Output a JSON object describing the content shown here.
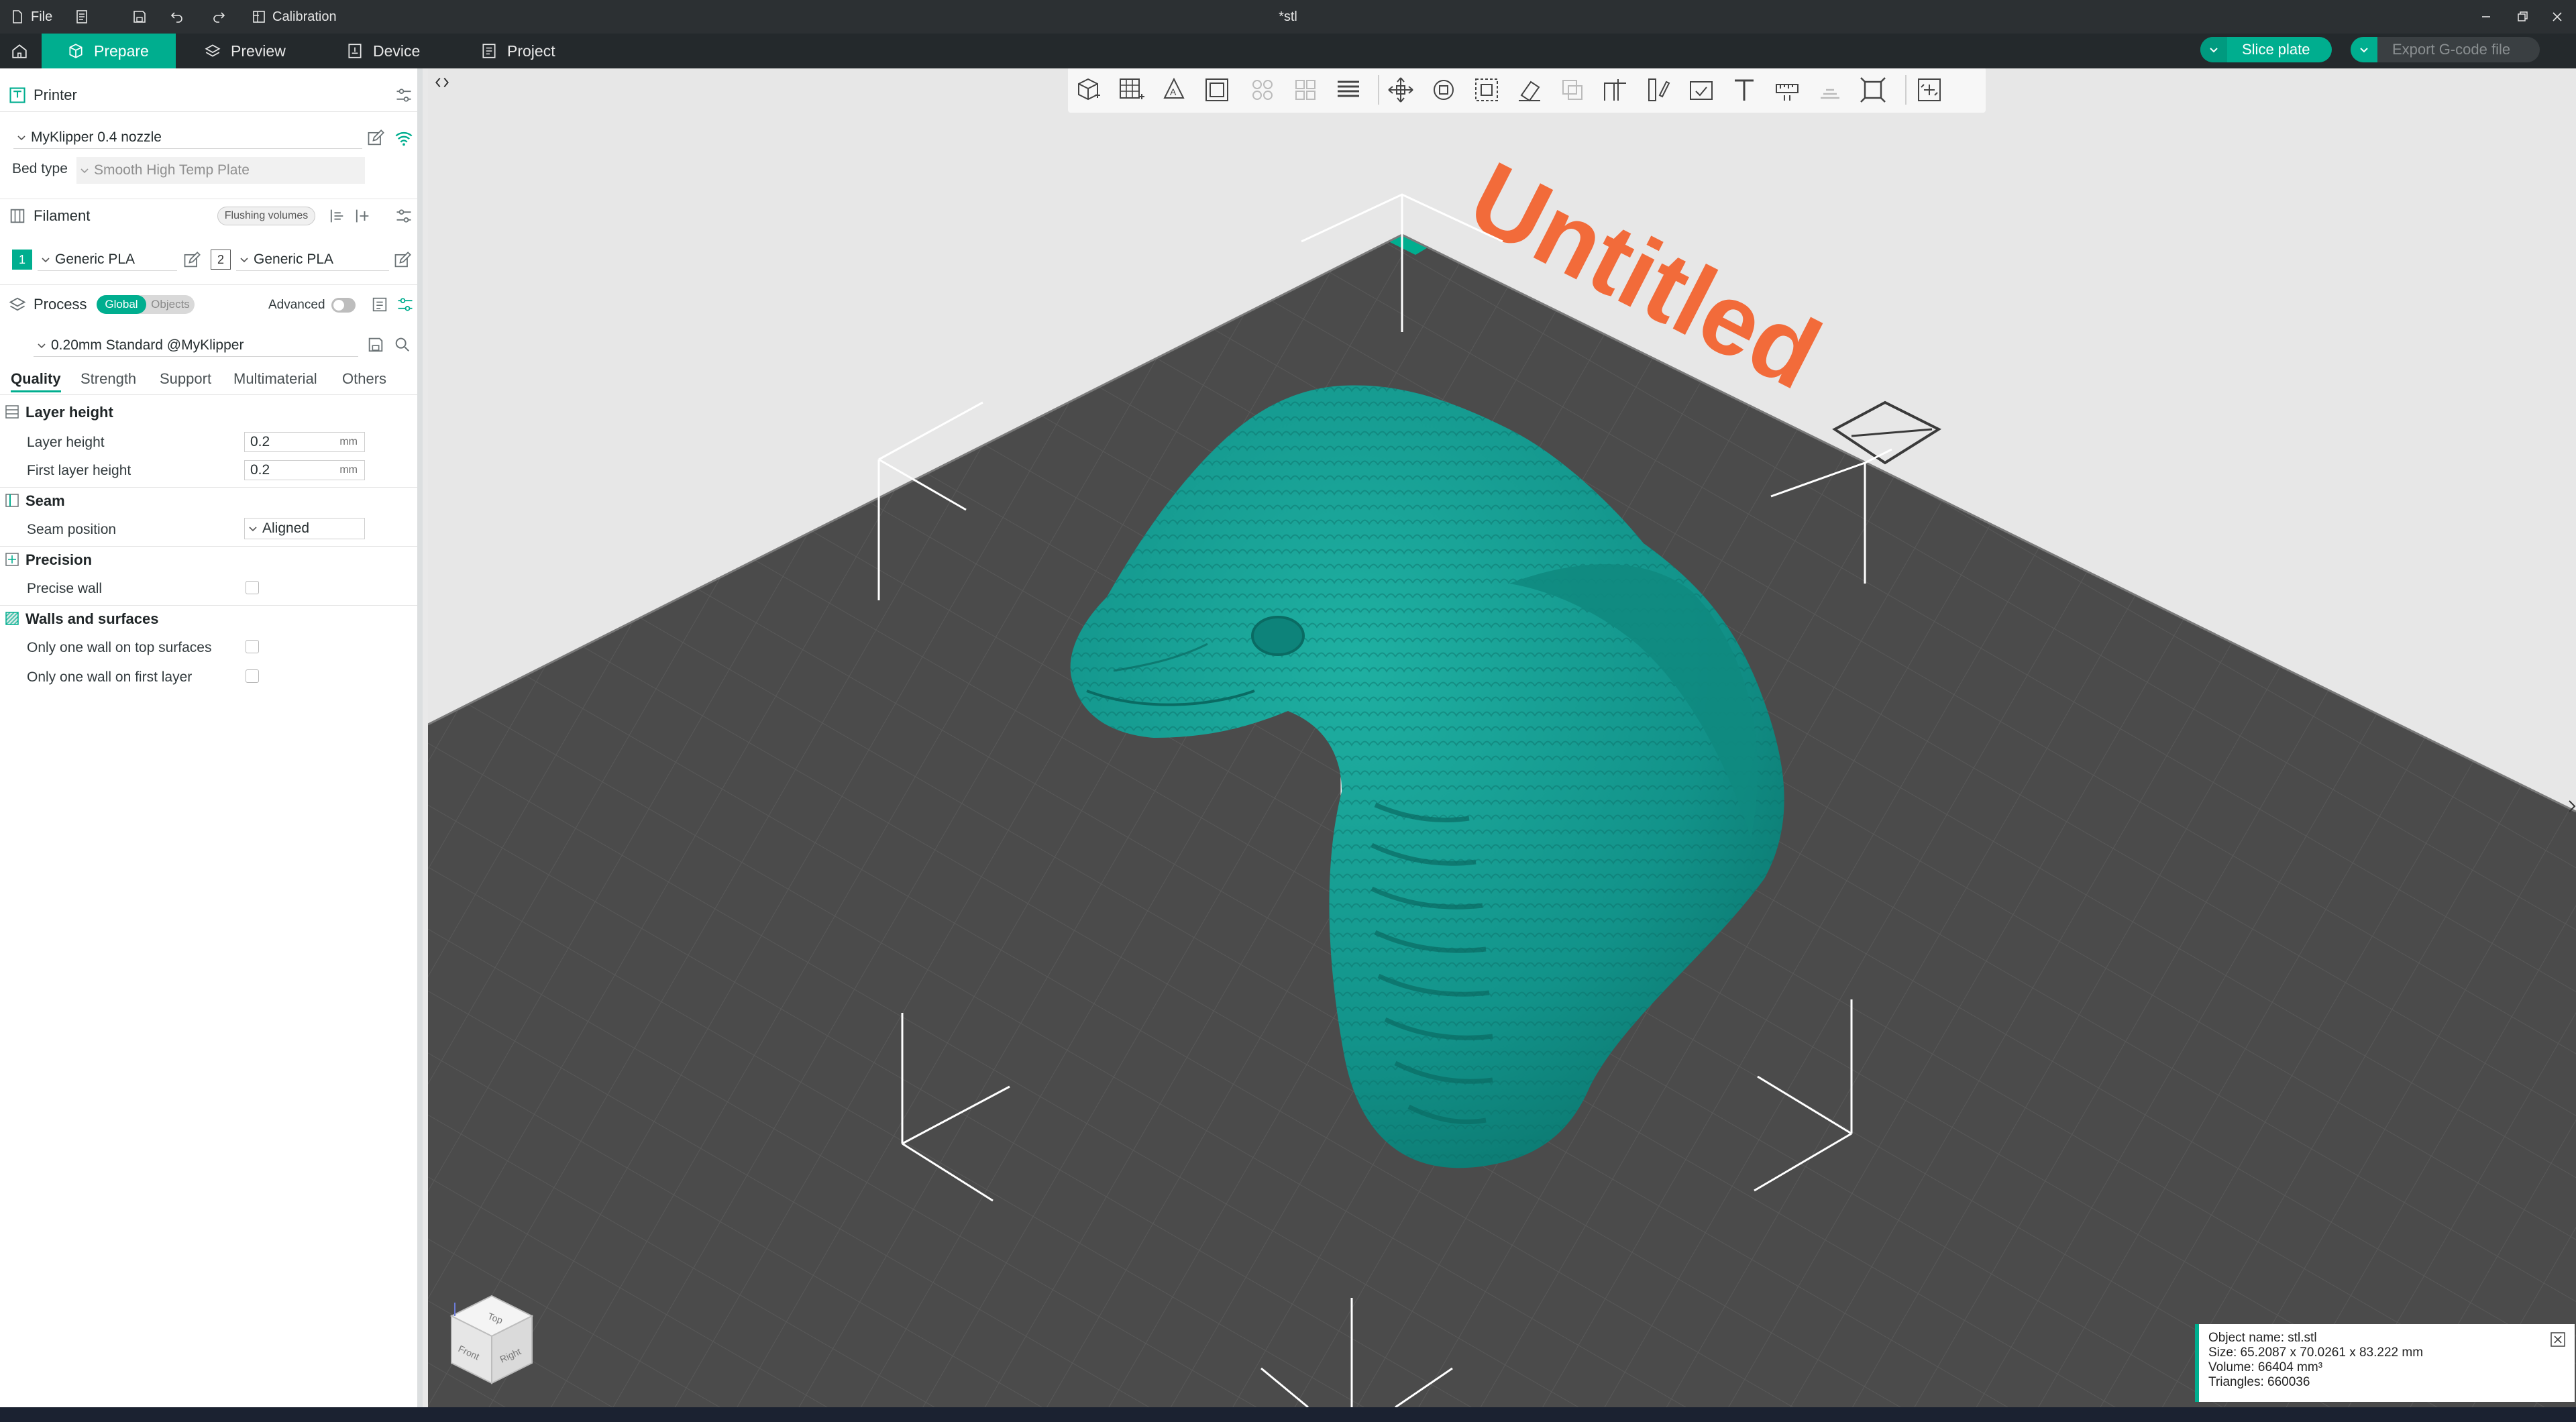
{
  "titlebar": {
    "file_label": "File",
    "calibration_label": "Calibration",
    "doc_title": "*stl"
  },
  "tabs": {
    "prepare": "Prepare",
    "preview": "Preview",
    "device": "Device",
    "project": "Project"
  },
  "actions": {
    "slice_plate": "Slice plate",
    "export_gcode": "Export G-code file"
  },
  "printer": {
    "section_title": "Printer",
    "selected": "MyKlipper 0.4 nozzle",
    "bed_type_label": "Bed type",
    "bed_type_value": "Smooth High Temp Plate"
  },
  "filament": {
    "section_title": "Filament",
    "flushing_label": "Flushing volumes",
    "slots": [
      {
        "index": "1",
        "name": "Generic PLA",
        "color": "#00ae8f"
      },
      {
        "index": "2",
        "name": "Generic PLA",
        "color": "#ffffff"
      }
    ]
  },
  "process": {
    "section_title": "Process",
    "toggle_global": "Global",
    "toggle_objects": "Objects",
    "advanced_label": "Advanced",
    "preset": "0.20mm Standard @MyKlipper",
    "tabs": [
      "Quality",
      "Strength",
      "Support",
      "Multimaterial",
      "Others"
    ],
    "groups": {
      "layer_height": {
        "title": "Layer height",
        "layer_height_label": "Layer height",
        "layer_height_value": "0.2",
        "first_layer_height_label": "First layer height",
        "first_layer_height_value": "0.2",
        "unit": "mm"
      },
      "seam": {
        "title": "Seam",
        "seam_position_label": "Seam position",
        "seam_position_value": "Aligned"
      },
      "precision": {
        "title": "Precision",
        "precise_wall_label": "Precise wall"
      },
      "walls": {
        "title": "Walls and surfaces",
        "one_wall_top_label": "Only one wall on top surfaces",
        "one_wall_first_label": "Only one wall on first layer"
      }
    }
  },
  "viewport": {
    "plate_label": "Untitled",
    "view_cube": {
      "top": "Top",
      "front": "Front",
      "right": "Right"
    }
  },
  "object_info": {
    "name": "Object name: stl.stl",
    "size": "Size: 65.2087 x 70.0261 x 83.222 mm",
    "volume": "Volume: 66404 mm³",
    "triangles": "Triangles: 660036"
  },
  "colors": {
    "accent": "#00ae8f",
    "model": "#14978b",
    "plate": "#4a4a4a",
    "plate_label": "#f26b3a",
    "titlebar": "#2c3033"
  }
}
